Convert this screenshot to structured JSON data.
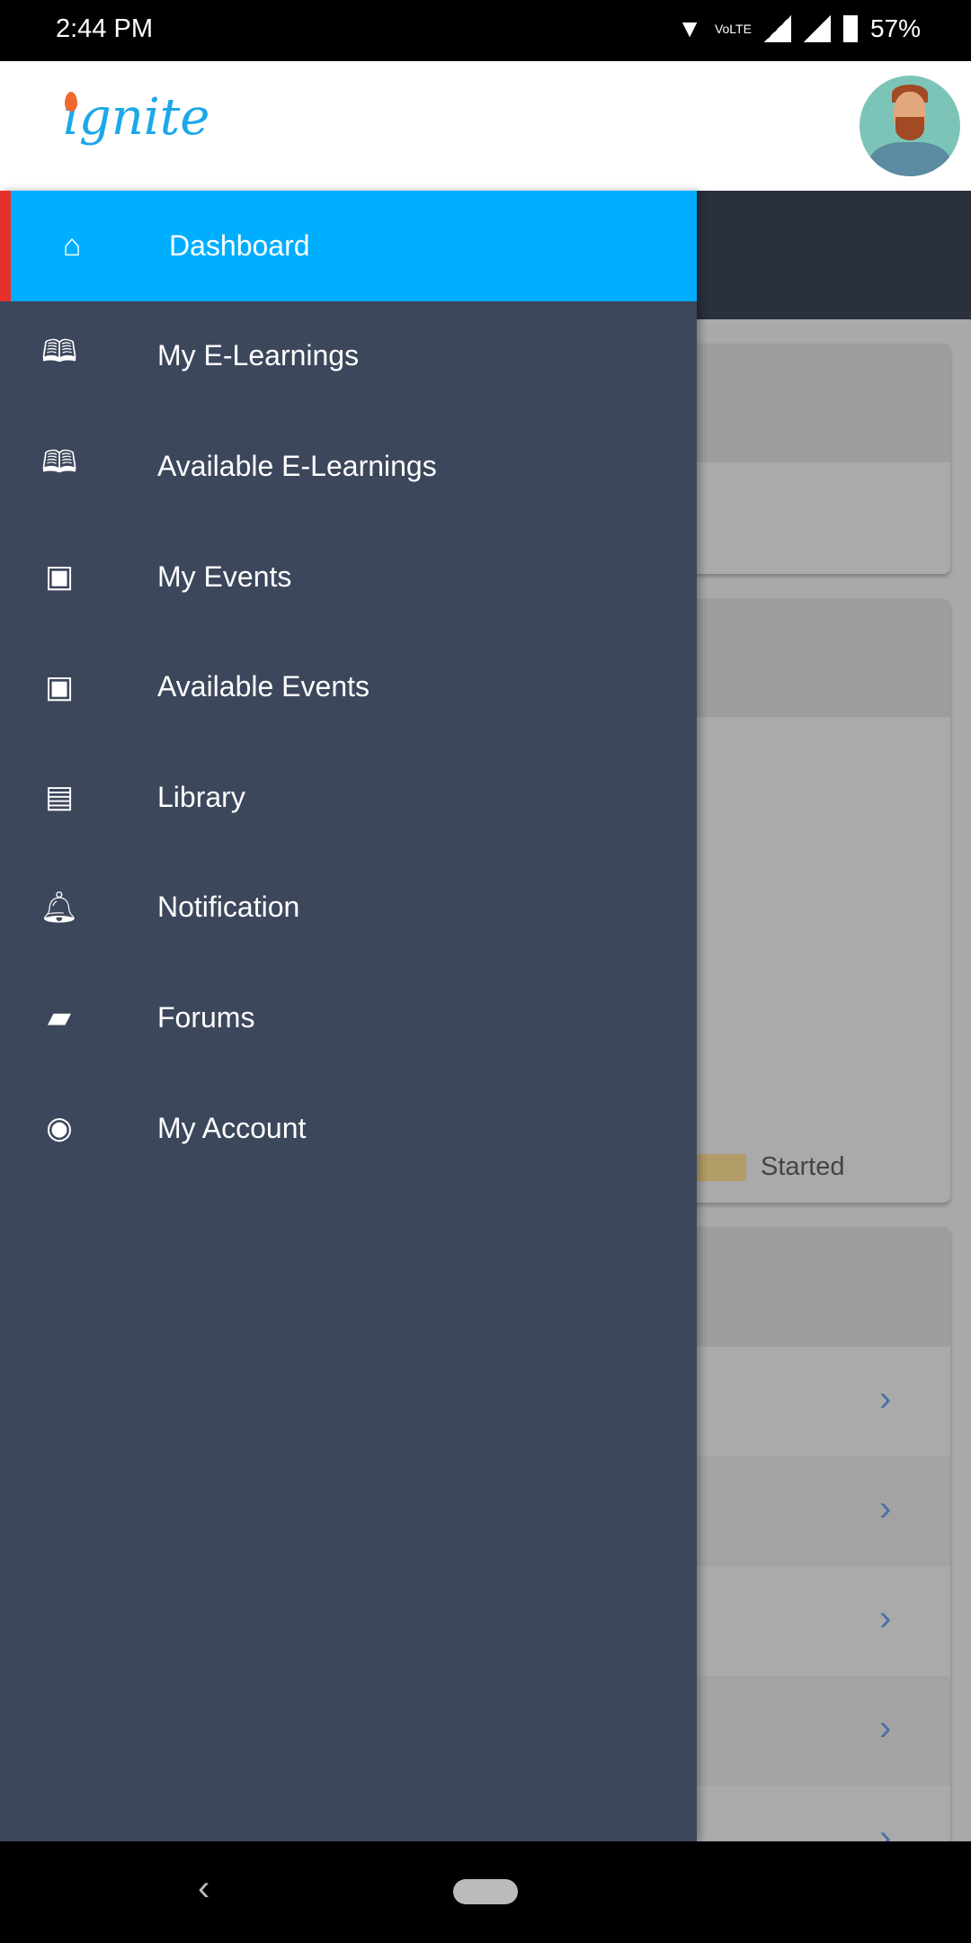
{
  "status_bar": {
    "time": "2:44 PM",
    "battery": "57%",
    "volte": "VoLTE"
  },
  "header": {
    "logo": "ignite",
    "avatar": "user-avatar"
  },
  "content": {
    "legend_label": "Started",
    "legend_color": "#b29d68"
  },
  "drawer": {
    "accent": "#00aeff",
    "items": [
      {
        "label": "Dashboard",
        "icon": "home-icon",
        "active": true
      },
      {
        "label": "My E-Learnings",
        "icon": "book-open-icon"
      },
      {
        "label": "Available E-Learnings",
        "icon": "book-open-icon"
      },
      {
        "label": "My Events",
        "icon": "calendar-icon"
      },
      {
        "label": "Available Events",
        "icon": "calendar-icon"
      },
      {
        "label": "Library",
        "icon": "archive-icon"
      },
      {
        "label": "Notification",
        "icon": "bell-icon"
      },
      {
        "label": "Forums",
        "icon": "forum-icon"
      },
      {
        "label": "My Account",
        "icon": "account-circle-icon"
      }
    ]
  }
}
